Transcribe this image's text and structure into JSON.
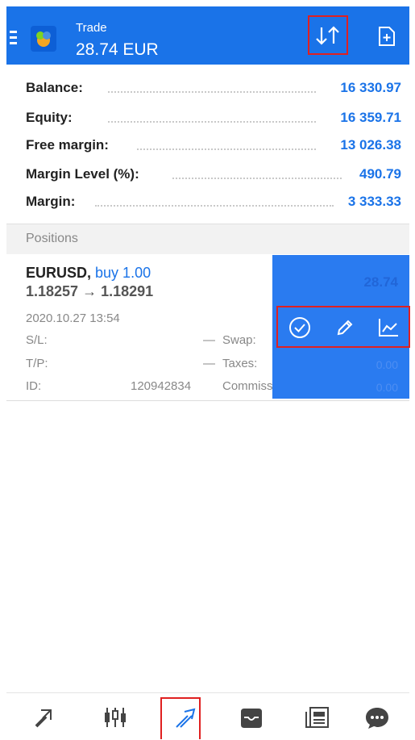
{
  "header": {
    "title": "Trade",
    "amount": "28.74 EUR"
  },
  "summary": [
    {
      "label": "Balance:",
      "value": "16 330.97"
    },
    {
      "label": "Equity:",
      "value": "16 359.71"
    },
    {
      "label": "Free margin:",
      "value": "13 026.38"
    },
    {
      "label": "Margin Level (%):",
      "value": "490.79"
    },
    {
      "label": "Margin:",
      "value": "3 333.33"
    }
  ],
  "positions_header": "Positions",
  "position": {
    "symbol": "EURUSD,",
    "side": "buy 1.00",
    "prices": "1.18257 → 1.18291",
    "time": "2020.10.27 13:54",
    "sl_label": "S/L:",
    "sl_value": "—",
    "tp_label": "T/P:",
    "tp_value": "—",
    "id_label": "ID:",
    "id_value": "120942834",
    "swap_label": "Swap:",
    "taxes_label": "Taxes:",
    "commission_label": "Commission:",
    "profit": "28.74",
    "taxes_value": "0.00",
    "commission_value": "0.00"
  },
  "colors": {
    "accent": "#1a73e8",
    "swipe": "#2a7bf0",
    "highlight": "#e02020"
  },
  "icons": {
    "sort": "sort-arrows-icon",
    "new_order": "new-order-icon",
    "close_position": "check-circle-icon",
    "modify": "pencil-icon",
    "chart": "chart-line-icon"
  },
  "nav": [
    "quotes-icon",
    "chart-candles-icon",
    "trade-icon",
    "history-icon",
    "news-icon",
    "chat-icon"
  ]
}
